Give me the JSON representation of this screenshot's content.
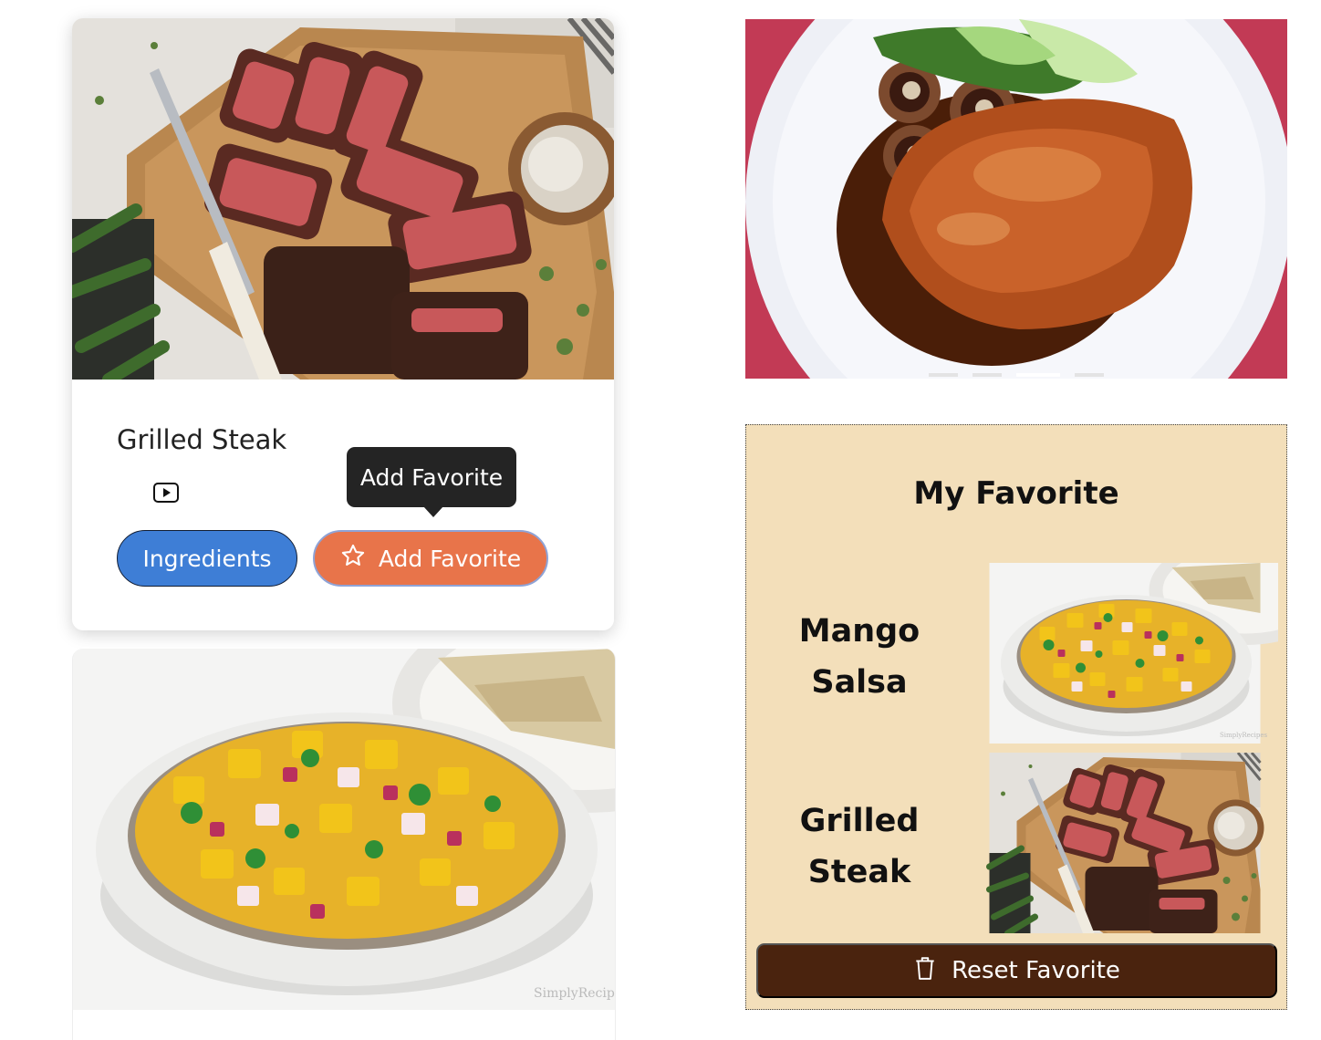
{
  "recipe_card": {
    "title": "Grilled Steak",
    "image_icon": "grilled-steak-photo",
    "video_icon": "youtube-icon",
    "ingredients_label": "Ingredients",
    "favorite_label": "Add Favorite",
    "favorite_icon": "star-icon",
    "tooltip": "Add Favorite"
  },
  "recipe_card_2": {
    "image_icon": "mango-salsa-photo"
  },
  "carousel": {
    "image_icon": "braised-pork-photo",
    "slide_count": 4,
    "active_index": 2
  },
  "favorites": {
    "title": "My Favorite",
    "items": [
      {
        "line1": "Mango",
        "line2": "Salsa",
        "image_icon": "mango-salsa-photo"
      },
      {
        "line1": "Grilled",
        "line2": "Steak",
        "image_icon": "grilled-steak-photo"
      }
    ],
    "reset_label": "Reset Favorite",
    "reset_icon": "trash-icon"
  },
  "colors": {
    "ingredients_button": "#3e7ed6",
    "favorite_button": "#e8744a",
    "favorites_panel": "#f3dfba",
    "reset_button": "#4a230e",
    "tooltip": "#242424"
  }
}
